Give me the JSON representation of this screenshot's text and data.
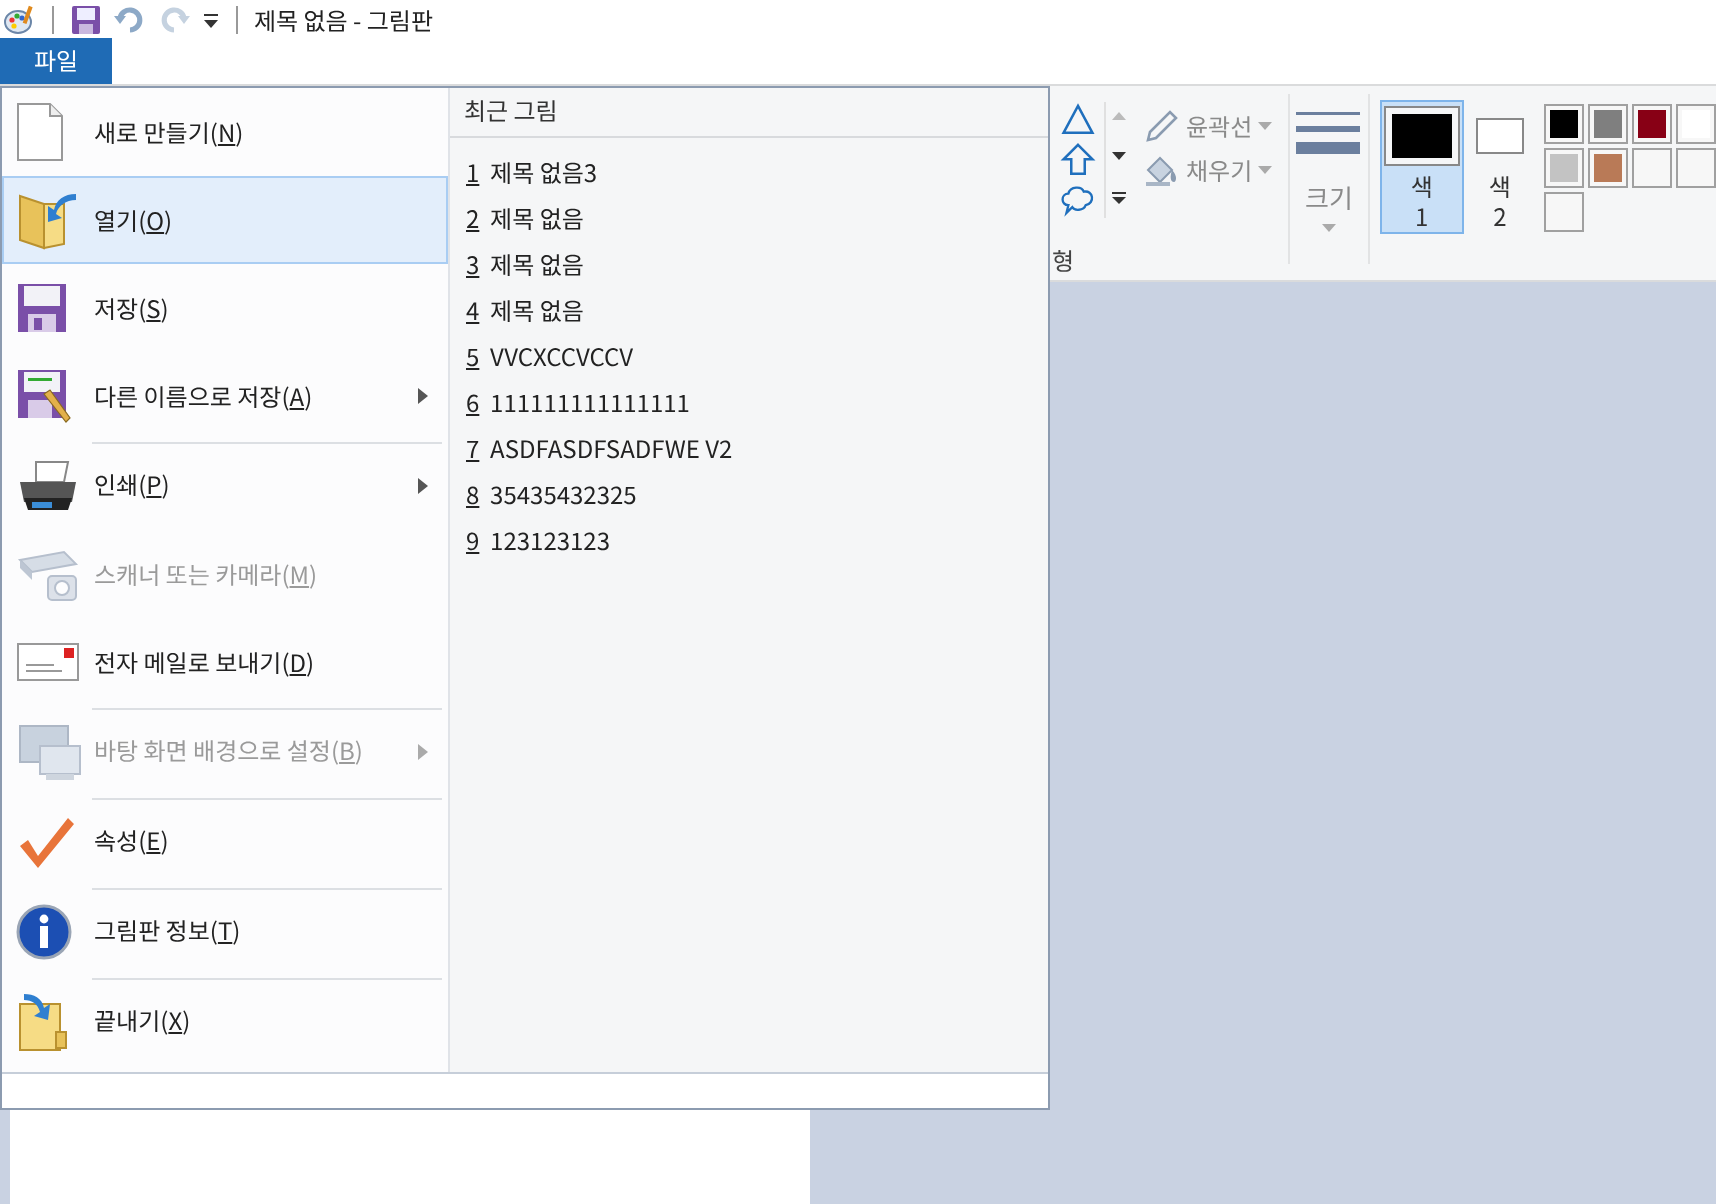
{
  "title_bar": {
    "title": "제목 없음 - 그림판"
  },
  "file_tab": {
    "label": "파일"
  },
  "ribbon": {
    "shapes_group_label": "형",
    "outline": {
      "label": "윤곽선"
    },
    "fill": {
      "label": "채우기"
    },
    "size": {
      "label": "크기"
    },
    "color_slots": [
      {
        "label": "색",
        "number": "1",
        "color": "#000000",
        "selected": true
      },
      {
        "label": "색",
        "number": "2",
        "color": "#ffffff",
        "selected": false
      }
    ],
    "palette": [
      {
        "kind": "swatch",
        "color": "#000000"
      },
      {
        "kind": "swatch",
        "color": "#7f7f7f"
      },
      {
        "kind": "swatch",
        "color": "#880015"
      },
      {
        "kind": "swatch",
        "color": "#ffffff"
      },
      {
        "kind": "swatch",
        "color": "#c3c3c3"
      },
      {
        "kind": "swatch",
        "color": "#b97a57"
      },
      {
        "kind": "empty"
      },
      {
        "kind": "empty"
      },
      {
        "kind": "empty"
      }
    ]
  },
  "file_menu": {
    "items": [
      {
        "kind": "new",
        "label": [
          "새로 만들기(",
          "N",
          ")"
        ],
        "selected": false,
        "disabled": false,
        "submenu": false,
        "separator_before": false
      },
      {
        "kind": "open",
        "label": [
          "열기(",
          "O",
          ")"
        ],
        "selected": true,
        "disabled": false,
        "submenu": false,
        "separator_before": false
      },
      {
        "kind": "save",
        "label": [
          "저장(",
          "S",
          ")"
        ],
        "selected": false,
        "disabled": false,
        "submenu": false,
        "separator_before": false
      },
      {
        "kind": "save_as",
        "label": [
          "다른 이름으로 저장(",
          "A",
          ")"
        ],
        "selected": false,
        "disabled": false,
        "submenu": true,
        "separator_before": false
      },
      {
        "kind": "print",
        "label": [
          "인쇄(",
          "P",
          ")"
        ],
        "selected": false,
        "disabled": false,
        "submenu": true,
        "separator_before": true
      },
      {
        "kind": "scanner",
        "label": [
          "스캐너 또는 카메라(",
          "M",
          ")"
        ],
        "selected": false,
        "disabled": true,
        "submenu": false,
        "separator_before": false
      },
      {
        "kind": "email",
        "label": [
          "전자 메일로 보내기(",
          "D",
          ")"
        ],
        "selected": false,
        "disabled": false,
        "submenu": false,
        "separator_before": false
      },
      {
        "kind": "desktop",
        "label": [
          "바탕 화면 배경으로 설정(",
          "B",
          ")"
        ],
        "selected": false,
        "disabled": true,
        "submenu": true,
        "separator_before": true
      },
      {
        "kind": "properties",
        "label": [
          "속성(",
          "E",
          ")"
        ],
        "selected": false,
        "disabled": false,
        "submenu": false,
        "separator_before": true
      },
      {
        "kind": "about",
        "label": [
          "그림판 정보(",
          "T",
          ")"
        ],
        "selected": false,
        "disabled": false,
        "submenu": false,
        "separator_before": true
      },
      {
        "kind": "exit",
        "label": [
          "끝내기(",
          "X",
          ")"
        ],
        "selected": false,
        "disabled": false,
        "submenu": false,
        "separator_before": true
      }
    ],
    "recent": {
      "heading": "최근 그림",
      "items": [
        {
          "number": "1",
          "name": "제목 없음3"
        },
        {
          "number": "2",
          "name": "제목 없음"
        },
        {
          "number": "3",
          "name": "제목 없음"
        },
        {
          "number": "4",
          "name": "제목 없음"
        },
        {
          "number": "5",
          "name": "VVCXCCVCCV"
        },
        {
          "number": "6",
          "name": "111111111111111"
        },
        {
          "number": "7",
          "name": "ASDFASDFSADFWE V2"
        },
        {
          "number": "8",
          "name": "35435432325"
        },
        {
          "number": "9",
          "name": "123123123"
        }
      ]
    }
  }
}
